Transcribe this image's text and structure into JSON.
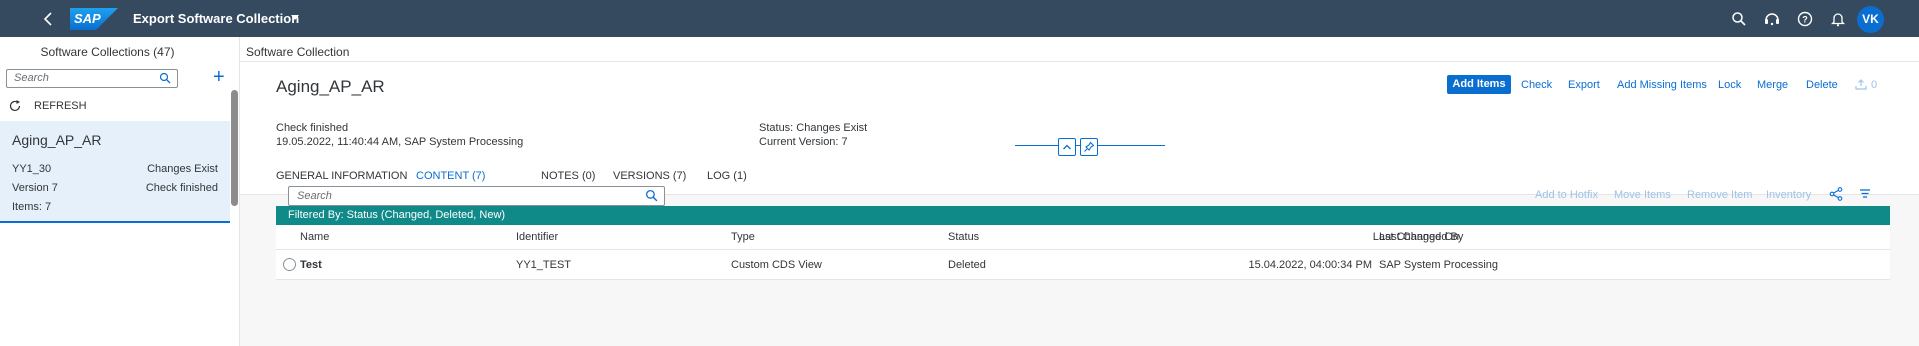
{
  "shell": {
    "app_title": "Export Software Collection",
    "logo_text": "SAP",
    "avatar_initials": "VK",
    "icons": [
      "back-icon",
      "search-icon",
      "notifications-support-icon",
      "help-icon",
      "bell-icon"
    ]
  },
  "master": {
    "header": "Software Collections (47)",
    "search_placeholder": "Search",
    "refresh_label": "REFRESH",
    "items": [
      {
        "title": "Aging_AP_AR",
        "left1": "YY1_30",
        "right1": "Changes Exist",
        "left2": "Version 7",
        "right2": "Check finished",
        "left3": "Items: 7"
      }
    ]
  },
  "detail": {
    "breadcrumb": "Software Collection",
    "title": "Aging_AP_AR",
    "actions": {
      "add_items": "Add Items",
      "check": "Check",
      "export": "Export",
      "add_missing": "Add Missing Items",
      "lock": "Lock",
      "merge": "Merge",
      "delete": "Delete",
      "count": "0"
    },
    "info": {
      "check_status": "Check finished",
      "check_time": "19.05.2022, 11:40:44 AM, SAP System Processing",
      "status": "Status: Changes Exist",
      "version": "Current Version: 7"
    },
    "tabs": [
      {
        "label": "GENERAL INFORMATION"
      },
      {
        "label": "CONTENT (7)"
      },
      {
        "label": "NOTES (0)"
      },
      {
        "label": "VERSIONS (7)"
      },
      {
        "label": "LOG (1)"
      }
    ],
    "selected_tab": "CONTENT (7)",
    "table": {
      "search_placeholder": "Search",
      "toolbar": {
        "add_hotfix": "Add to Hotfix",
        "move_items": "Move Items",
        "remove_item": "Remove Item",
        "inventory": "Inventory"
      },
      "filter_text": "Filtered By: Status (Changed, Deleted, New)",
      "columns": {
        "name": "Name",
        "identifier": "Identifier",
        "type": "Type",
        "status": "Status",
        "last_changed_on": "Last Changed On",
        "last_changed_by": "Last Changed By"
      },
      "rows": [
        {
          "name": "Test",
          "identifier": "YY1_TEST",
          "type": "Custom CDS View",
          "status": "Deleted",
          "last_changed_on": "15.04.2022, 04:00:34 PM",
          "last_changed_by": "SAP System Processing"
        }
      ]
    }
  },
  "colors": {
    "shell": "#354a5f",
    "accent": "#0a6ed1",
    "filter_bar": "#108a88",
    "selected_item": "#e5f0fa"
  }
}
